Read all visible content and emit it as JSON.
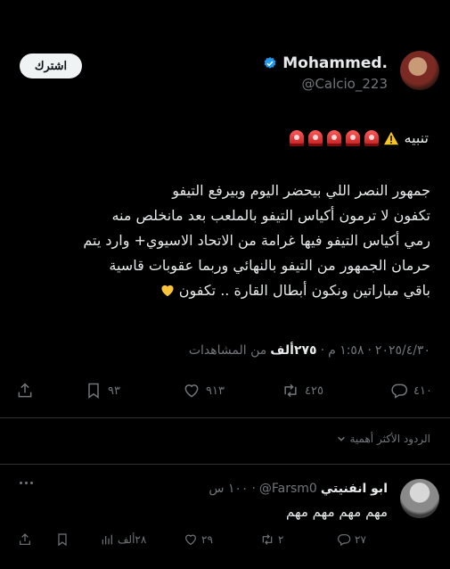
{
  "author": {
    "name": "Mohammed.",
    "handle": "@Calcio_223"
  },
  "subscribe_label": "اشترك",
  "tweet": {
    "alert_label": "تنبيه",
    "lines": [
      "جمهور النصر اللي بيحضر اليوم  وبيرفع التيفو",
      "تكفون لا ترمون أكياس التيفو بالملعب بعد مانخلص منه",
      "رمي أكياس التيفو فيها غرامة من الاتحاد الاسيوي+ وارد يتم",
      "حرمان الجمهور من التيفو بالنهائي وربما عقوبات قاسية",
      "باقي مباراتين ونكون أبطال القارة .. تكفون"
    ],
    "date": "٢٠٢٥/٤/٣٠",
    "time": "١:٥٨ م",
    "views": "٢٧٥ألف",
    "views_label": "من المشاهدات"
  },
  "actions": {
    "replies": "٤١٠",
    "retweets": "٤٢٥",
    "likes": "٩١٣",
    "bookmarks": "٩٣"
  },
  "replies_sort_label": "الردود الأكثر أهمية",
  "reply": {
    "name": "ابو انفنيتي",
    "handle": "@Farsm0",
    "time": "١٠٠ س",
    "text": "مهم مهم مهم مهم",
    "actions": {
      "replies": "٢٧",
      "retweets": "٢",
      "likes": "٢٩",
      "views": "٢٨ألف"
    }
  },
  "colors": {
    "background": "#000000",
    "text": "#e7e9ea",
    "muted": "#71767b",
    "verified": "#1d9bf0"
  }
}
